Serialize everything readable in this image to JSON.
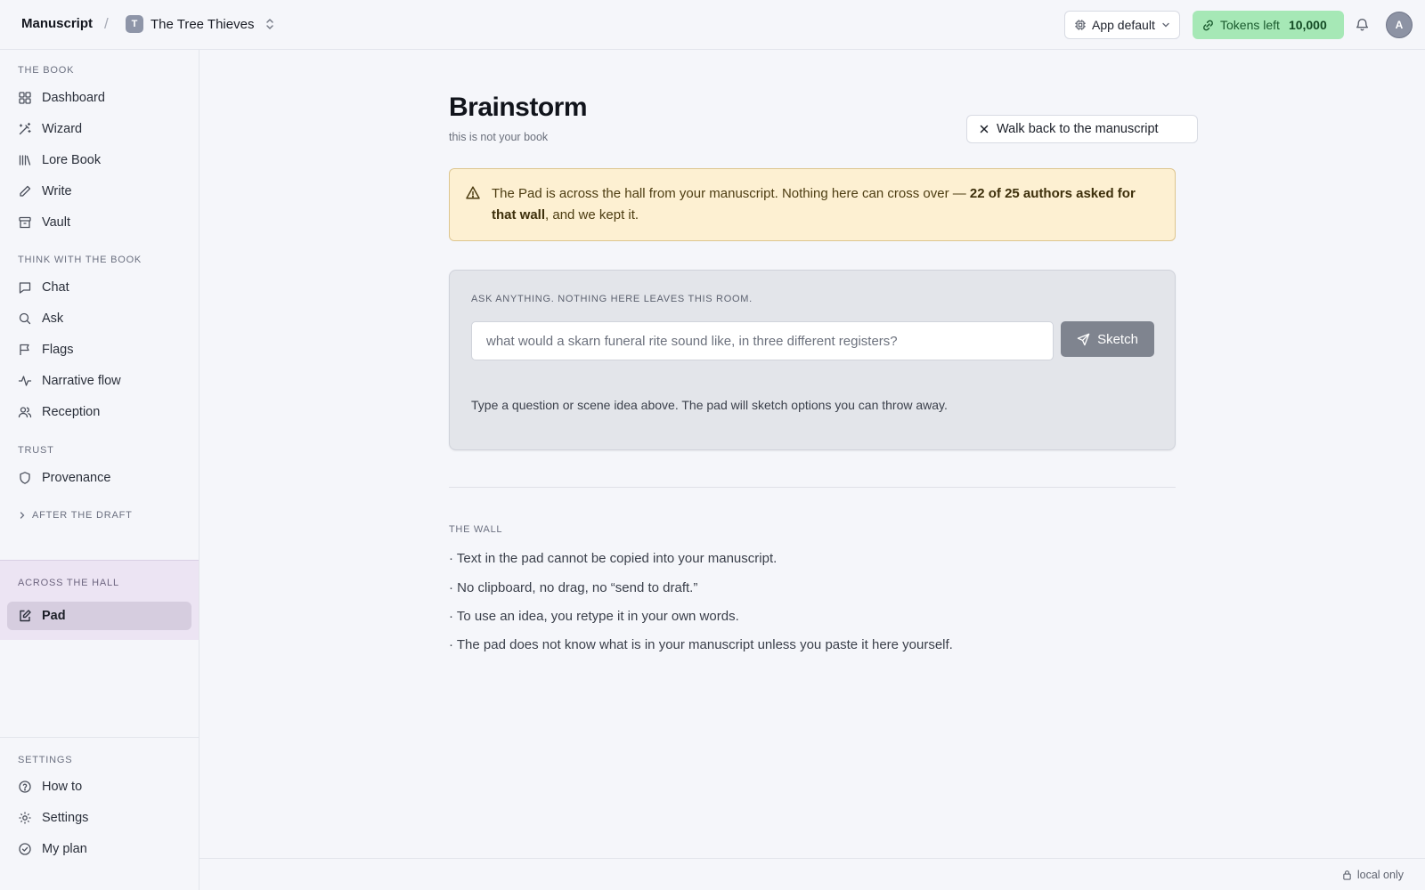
{
  "topbar": {
    "brand": "Manuscript",
    "separator": "/",
    "project_initial": "T",
    "project_name": "The Tree Thieves",
    "model_select": "App default",
    "tokens_label": "Tokens left",
    "tokens_value": "10,000",
    "user_initial": "A"
  },
  "sidebar": {
    "sections": [
      {
        "title": "THE BOOK",
        "items": [
          "Dashboard",
          "Wizard",
          "Lore Book",
          "Write",
          "Vault"
        ]
      },
      {
        "title": "THINK WITH THE BOOK",
        "items": [
          "Chat",
          "Ask",
          "Flags",
          "Narrative flow",
          "Reception"
        ]
      },
      {
        "title": "TRUST",
        "items": [
          "Provenance"
        ]
      }
    ],
    "collapsed_section": "AFTER THE DRAFT",
    "hall": {
      "title": "ACROSS THE HALL",
      "item": "Pad"
    },
    "settings": {
      "title": "SETTINGS",
      "items": [
        "How to",
        "Settings",
        "My plan"
      ]
    }
  },
  "main": {
    "title": "Brainstorm",
    "subtitle": "this is not your book",
    "back_button": "Walk back to the manuscript",
    "warning": {
      "text_before": "The Pad is across the hall from your manuscript. Nothing here can cross over — ",
      "text_bold": "22 of 25 authors asked for that wall",
      "text_after": ", and we kept it."
    },
    "ask": {
      "label": "ASK ANYTHING. NOTHING HERE LEAVES THIS ROOM.",
      "placeholder": "what would a skarn funeral rite sound like, in three different registers?",
      "button": "Sketch",
      "help": "Type a question or scene idea above. The pad will sketch options you can throw away."
    },
    "wall": {
      "title": "THE WALL",
      "items": [
        "· Text in the pad cannot be copied into your manuscript.",
        "· No clipboard, no drag, no “send to draft.”",
        "· To use an idea, you retype it in your own words.",
        "· The pad does not know what is in your manuscript unless you paste it here yourself."
      ]
    }
  },
  "footer": {
    "status": "local only"
  },
  "icons": {
    "sidebar": [
      "grid-icon",
      "wand-icon",
      "library-icon",
      "pencil-icon",
      "archive-icon",
      "chat-icon",
      "search-icon",
      "flag-icon",
      "activity-icon",
      "users-icon",
      "shield-icon",
      "chevron-right-icon",
      "note-edit-icon",
      "help-circle-icon",
      "gear-icon",
      "check-circle-icon"
    ],
    "topbar": [
      "chevrons-updown-icon",
      "cpu-icon",
      "chevron-down-icon",
      "link-icon",
      "bell-icon"
    ],
    "main": [
      "close-icon",
      "alert-triangle-icon",
      "send-icon",
      "lock-icon"
    ]
  },
  "colors": {
    "tokens_bg": "#a6e8b6",
    "warning_bg": "#fdf0d2",
    "hall_bg": "#ece4f3",
    "sketch_button": "#7f848f"
  }
}
